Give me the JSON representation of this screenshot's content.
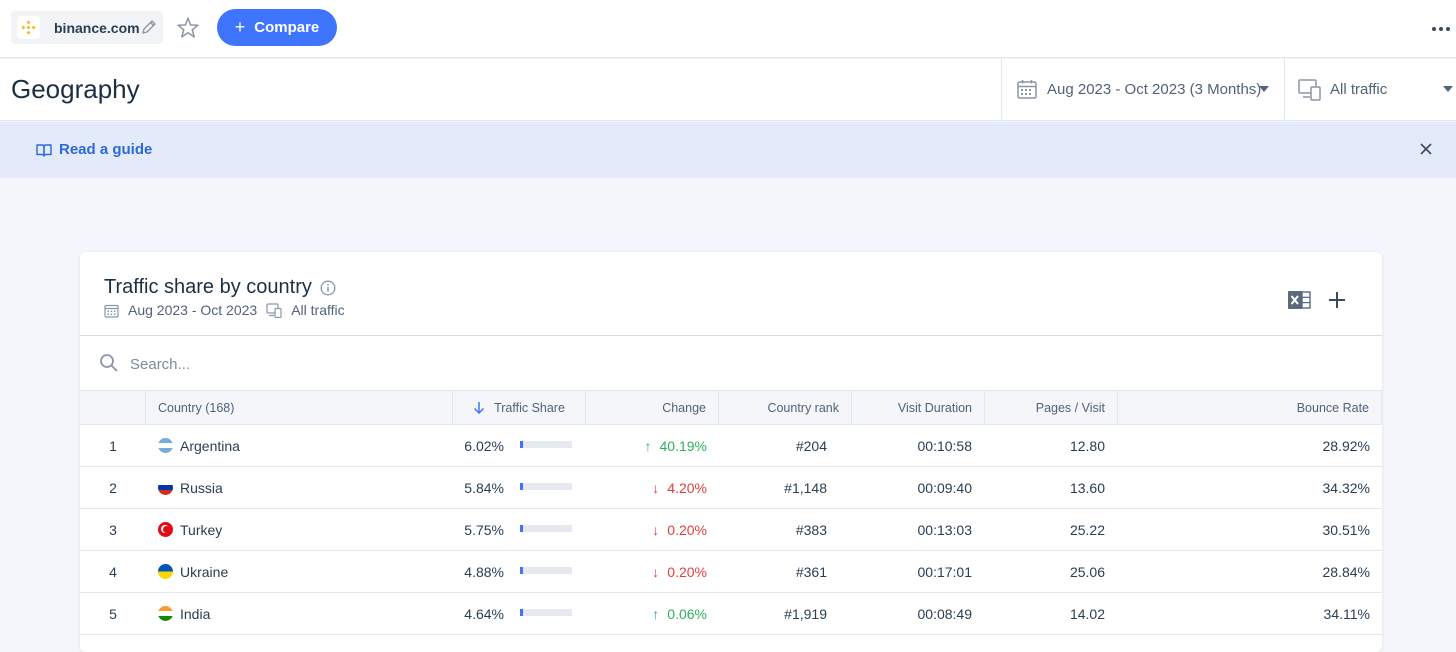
{
  "topbar": {
    "site": "binance.com",
    "compare_label": "Compare"
  },
  "header": {
    "title": "Geography",
    "date_range": "Aug 2023 - Oct 2023 (3 Months)",
    "traffic": "All traffic"
  },
  "guide": {
    "link": "Read a guide"
  },
  "card": {
    "title": "Traffic share by country",
    "date": "Aug 2023 - Oct 2023",
    "traffic": "All traffic",
    "search_placeholder": "Search..."
  },
  "table": {
    "headers": {
      "country": "Country (168)",
      "traffic_share": "Traffic Share",
      "change": "Change",
      "rank": "Country rank",
      "duration": "Visit Duration",
      "pages": "Pages / Visit",
      "bounce": "Bounce Rate"
    },
    "rows": [
      {
        "index": "1",
        "country": "Argentina",
        "flag": "argentina",
        "share": "6.02%",
        "share_value": 6.02,
        "change": "40.19%",
        "direction": "up",
        "rank": "#204",
        "duration": "00:10:58",
        "pages": "12.80",
        "bounce": "28.92%"
      },
      {
        "index": "2",
        "country": "Russia",
        "flag": "russia",
        "share": "5.84%",
        "share_value": 5.84,
        "change": "4.20%",
        "direction": "down",
        "rank": "#1,148",
        "duration": "00:09:40",
        "pages": "13.60",
        "bounce": "34.32%"
      },
      {
        "index": "3",
        "country": "Turkey",
        "flag": "turkey",
        "share": "5.75%",
        "share_value": 5.75,
        "change": "0.20%",
        "direction": "down",
        "rank": "#383",
        "duration": "00:13:03",
        "pages": "25.22",
        "bounce": "30.51%"
      },
      {
        "index": "4",
        "country": "Ukraine",
        "flag": "ukraine",
        "share": "4.88%",
        "share_value": 4.88,
        "change": "0.20%",
        "direction": "down",
        "rank": "#361",
        "duration": "00:17:01",
        "pages": "25.06",
        "bounce": "28.84%"
      },
      {
        "index": "5",
        "country": "India",
        "flag": "india",
        "share": "4.64%",
        "share_value": 4.64,
        "change": "0.06%",
        "direction": "up",
        "rank": "#1,919",
        "duration": "00:08:49",
        "pages": "14.02",
        "bounce": "34.11%"
      }
    ]
  },
  "colors": {
    "accent": "#3e74fe",
    "up": "#2eaf5e",
    "down": "#e33e3e",
    "guide_bg": "#e3ebfb"
  }
}
